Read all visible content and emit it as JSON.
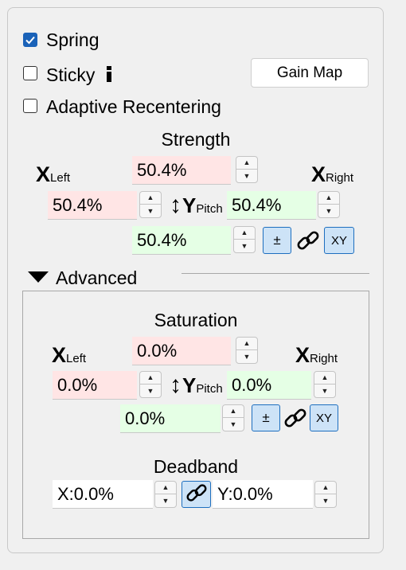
{
  "options": {
    "spring": {
      "label": "Spring",
      "checked": true
    },
    "sticky": {
      "label": "Sticky",
      "info_icon": "info-icon",
      "checked": false
    },
    "adaptive": {
      "label": "Adaptive Recentering",
      "checked": false
    },
    "gain_map_label": "Gain Map"
  },
  "strength": {
    "title": "Strength",
    "x_axis": "X",
    "left_sub": "Left",
    "right_sub": "Right",
    "y_axis": "Y",
    "pitch_sub": "Pitch",
    "top_value": "50.4%",
    "left_value": "50.4%",
    "right_value": "50.4%",
    "bottom_value": "50.4%",
    "plusminus_label": "±",
    "xy_label": "XY"
  },
  "advanced": {
    "label": "Advanced",
    "expanded": true
  },
  "saturation": {
    "title": "Saturation",
    "x_axis": "X",
    "left_sub": "Left",
    "right_sub": "Right",
    "y_axis": "Y",
    "pitch_sub": "Pitch",
    "top_value": "0.0%",
    "left_value": "0.0%",
    "right_value": "0.0%",
    "bottom_value": "0.0%",
    "plusminus_label": "±",
    "xy_label": "XY"
  },
  "deadband": {
    "title": "Deadband",
    "x_value": "X:0.0%",
    "y_value": "Y:0.0%"
  },
  "colors": {
    "checkbox_accent": "#1a62b8",
    "negative_bg": "#ffe5e5",
    "positive_bg": "#e5ffe5",
    "toggle_bg": "#cde3f7"
  }
}
